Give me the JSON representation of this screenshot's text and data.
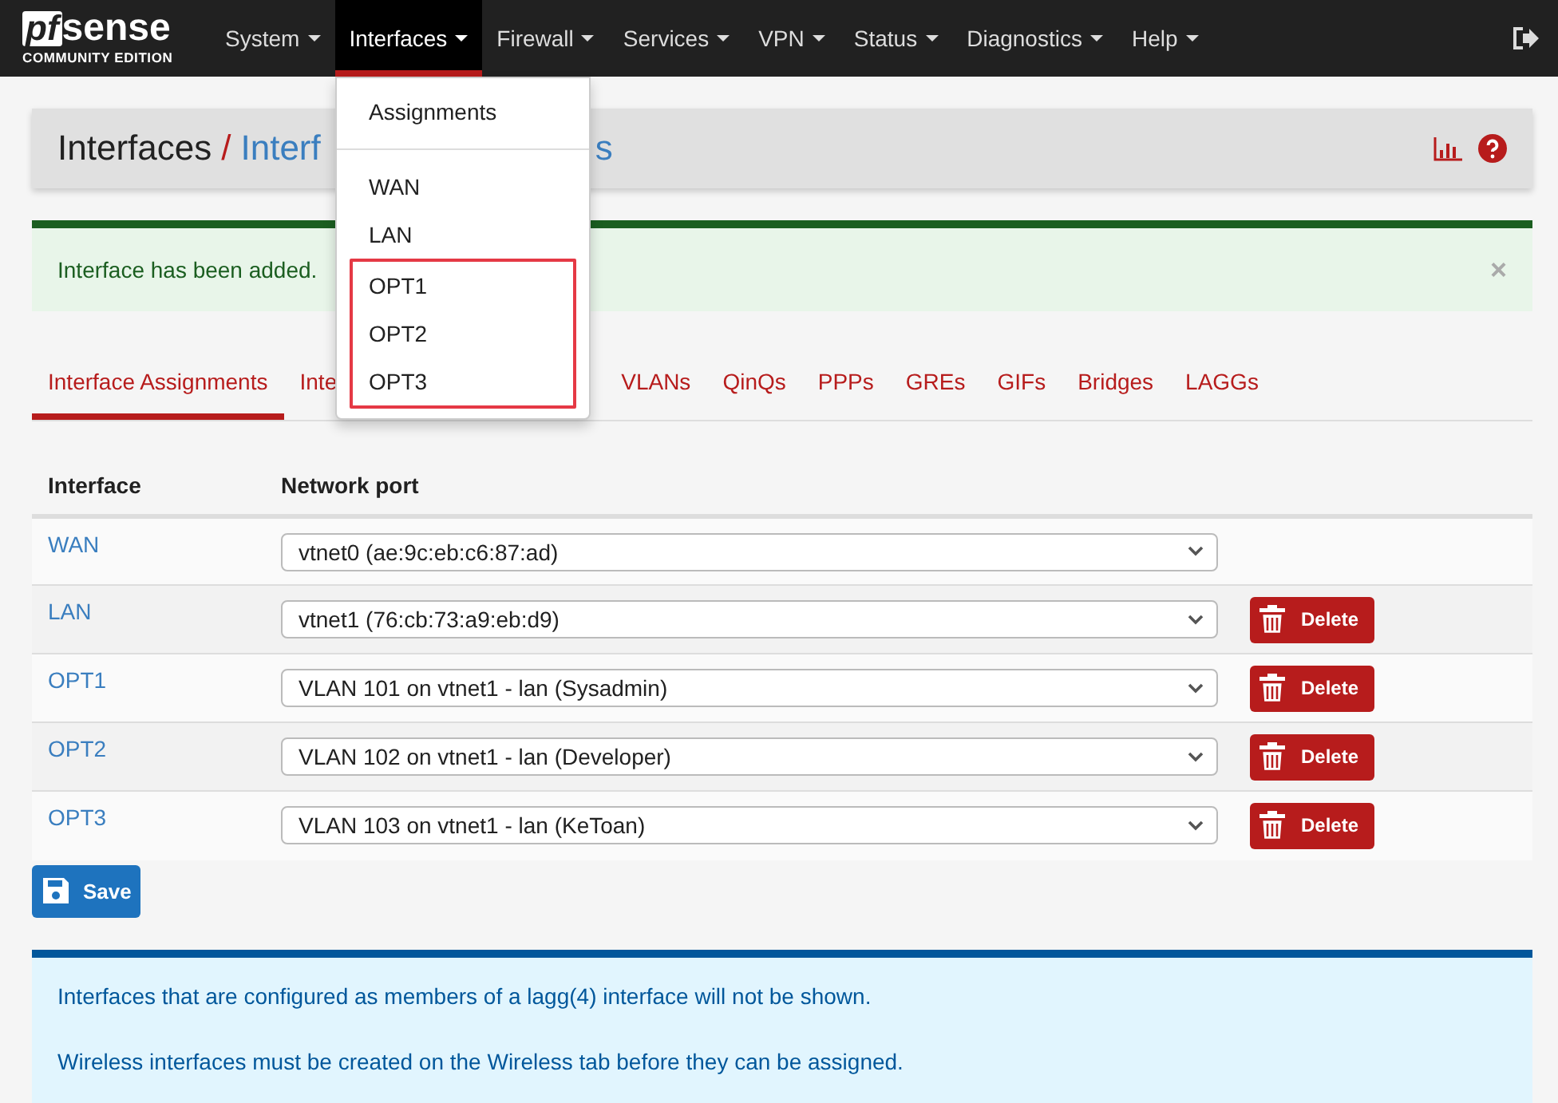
{
  "logo": {
    "mark": "pf",
    "name": "sense",
    "edition": "COMMUNITY EDITION"
  },
  "nav": [
    {
      "label": "System",
      "selected": false
    },
    {
      "label": "Interfaces",
      "selected": true
    },
    {
      "label": "Firewall",
      "selected": false
    },
    {
      "label": "Services",
      "selected": false
    },
    {
      "label": "VPN",
      "selected": false
    },
    {
      "label": "Status",
      "selected": false
    },
    {
      "label": "Diagnostics",
      "selected": false
    },
    {
      "label": "Help",
      "selected": false
    }
  ],
  "dropdown": {
    "items": [
      {
        "kind": "item",
        "label": "Assignments",
        "highlighted": false
      },
      {
        "kind": "divider"
      },
      {
        "kind": "item",
        "label": "WAN",
        "highlighted": false
      },
      {
        "kind": "item",
        "label": "LAN",
        "highlighted": false
      },
      {
        "kind": "item",
        "label": "OPT1",
        "highlighted": true
      },
      {
        "kind": "item",
        "label": "OPT2",
        "highlighted": true
      },
      {
        "kind": "item",
        "label": "OPT3",
        "highlighted": true
      }
    ]
  },
  "breadcrumb": {
    "section": "Interfaces",
    "separator": "/",
    "page_start": "Interf",
    "page_end": "s"
  },
  "alert": {
    "message": "Interface has been added.",
    "close": "×"
  },
  "tabs": [
    {
      "label": "Interface Assignments",
      "selected": true,
      "covered": false
    },
    {
      "label": "Inte",
      "selected": false,
      "covered": true
    },
    {
      "label": "VLANs",
      "selected": false,
      "covered": false
    },
    {
      "label": "QinQs",
      "selected": false,
      "covered": false
    },
    {
      "label": "PPPs",
      "selected": false,
      "covered": false
    },
    {
      "label": "GREs",
      "selected": false,
      "covered": false
    },
    {
      "label": "GIFs",
      "selected": false,
      "covered": false
    },
    {
      "label": "Bridges",
      "selected": false,
      "covered": false
    },
    {
      "label": "LAGGs",
      "selected": false,
      "covered": false
    }
  ],
  "table": {
    "columns": [
      "Interface",
      "Network port"
    ],
    "rows": [
      {
        "interface": "WAN",
        "port": "vtnet0 (ae:9c:eb:c6:87:ad)",
        "action": null
      },
      {
        "interface": "LAN",
        "port": "vtnet1 (76:cb:73:a9:eb:d9)",
        "action": "Delete"
      },
      {
        "interface": "OPT1",
        "port": "VLAN 101 on vtnet1 - lan (Sysadmin)",
        "action": "Delete"
      },
      {
        "interface": "OPT2",
        "port": "VLAN 102 on vtnet1 - lan (Developer)",
        "action": "Delete"
      },
      {
        "interface": "OPT3",
        "port": "VLAN 103 on vtnet1 - lan (KeToan)",
        "action": "Delete"
      }
    ]
  },
  "save_button": "Save",
  "info": [
    "Interfaces that are configured as members of a lagg(4) interface will not be shown.",
    "Wireless interfaces must be created on the Wireless tab before they can be assigned."
  ]
}
